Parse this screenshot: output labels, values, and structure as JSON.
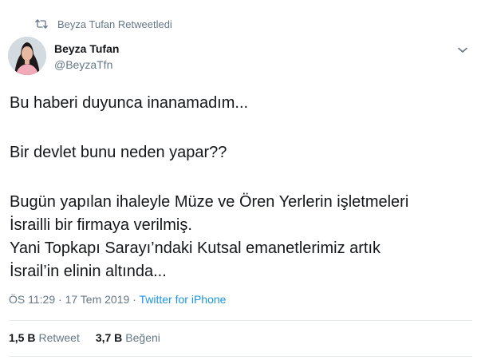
{
  "retweet": {
    "icon": "retweet-icon",
    "text": "Beyza Tufan Retweetledi"
  },
  "author": {
    "display_name": "Beyza Tufan",
    "handle": "@BeyzaTfn",
    "avatar_icon": "profile-avatar"
  },
  "tweet": {
    "lines": {
      "l1": "Bu haberi duyunca inanamadım...",
      "l2": "Bir devlet bunu neden yapar??",
      "l3": "Bugün yapılan ihaleyle Müze ve Ören Yerlerin işletmeleri",
      "l4": "İsrailli bir firmaya verilmiş.",
      "l5": "Yani Topkapı Sarayı’ndaki Kutsal emanetlerimiz artık",
      "l6": "İsrail’in elinin altında..."
    }
  },
  "meta": {
    "time": "ÖS 11:29",
    "separator": " · ",
    "date": "17 Tem 2019",
    "separator2": " · ",
    "source": "Twitter for iPhone"
  },
  "stats": {
    "retweet_count": "1,5 B",
    "retweet_label": "Retweet",
    "like_count": "3,7 B",
    "like_label": "Beğeni"
  },
  "colors": {
    "text": "#14171a",
    "secondary": "#657786",
    "link": "#1b95e0",
    "divider": "#e6ecf0"
  }
}
